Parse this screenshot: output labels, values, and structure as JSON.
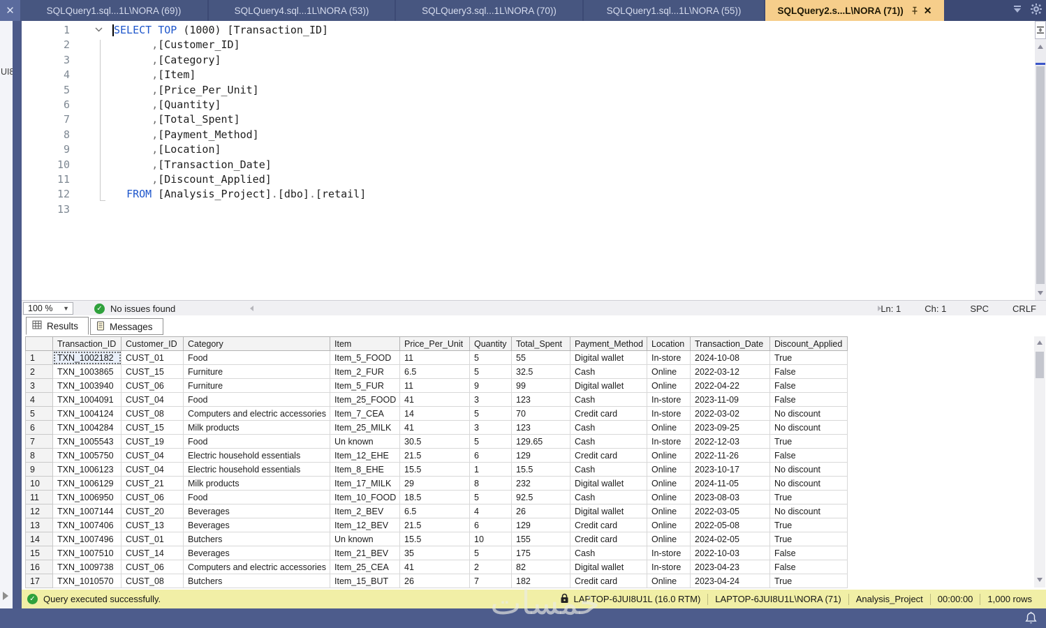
{
  "window": {
    "app": "SQL Server Management Studio"
  },
  "tab_bar": {
    "close_all_label": "✕",
    "tabs": [
      {
        "label": "SQLQuery1.sql...1L\\NORA (69))",
        "active": false
      },
      {
        "label": "SQLQuery4.sql...1L\\NORA (53))",
        "active": false
      },
      {
        "label": "SQLQuery3.sql...1L\\NORA (70))",
        "active": false
      },
      {
        "label": "SQLQuery1.sql...1L\\NORA (55))",
        "active": false
      },
      {
        "label": "SQLQuery2.s...L\\NORA (71))",
        "active": true
      }
    ]
  },
  "side_strip": {
    "label": "UI8"
  },
  "editor": {
    "keywords": [
      "SELECT",
      "TOP",
      "FROM"
    ],
    "lines": [
      "SELECT TOP (1000) [Transaction_ID]",
      "      ,[Customer_ID]",
      "      ,[Category]",
      "      ,[Item]",
      "      ,[Price_Per_Unit]",
      "      ,[Quantity]",
      "      ,[Total_Spent]",
      "      ,[Payment_Method]",
      "      ,[Location]",
      "      ,[Transaction_Date]",
      "      ,[Discount_Applied]",
      "  FROM [Analysis_Project].[dbo].[retail]",
      ""
    ]
  },
  "editor_status": {
    "zoom": "100 %",
    "health": "No issues found",
    "line": "Ln: 1",
    "char": "Ch: 1",
    "spaces": "SPC",
    "eol": "CRLF"
  },
  "results_panel": {
    "tabs": [
      {
        "label": "Results",
        "active": true
      },
      {
        "label": "Messages",
        "active": false
      }
    ]
  },
  "grid": {
    "columns": [
      "Transaction_ID",
      "Customer_ID",
      "Category",
      "Item",
      "Price_Per_Unit",
      "Quantity",
      "Total_Spent",
      "Payment_Method",
      "Location",
      "Transaction_Date",
      "Discount_Applied"
    ],
    "selected_cell": {
      "row": 0,
      "col": 0
    },
    "rows": [
      [
        "TXN_1002182",
        "CUST_01",
        "Food",
        "Item_5_FOOD",
        "11",
        "5",
        "55",
        "Digital wallet",
        "In-store",
        "2024-10-08",
        "True"
      ],
      [
        "TXN_1003865",
        "CUST_15",
        "Furniture",
        "Item_2_FUR",
        "6.5",
        "5",
        "32.5",
        "Cash",
        "Online",
        "2022-03-12",
        "False"
      ],
      [
        "TXN_1003940",
        "CUST_06",
        "Furniture",
        "Item_5_FUR",
        "11",
        "9",
        "99",
        "Digital wallet",
        "Online",
        "2022-04-22",
        "False"
      ],
      [
        "TXN_1004091",
        "CUST_04",
        "Food",
        "Item_25_FOOD",
        "41",
        "3",
        "123",
        "Cash",
        "In-store",
        "2023-11-09",
        "False"
      ],
      [
        "TXN_1004124",
        "CUST_08",
        "Computers and electric accessories",
        "Item_7_CEA",
        "14",
        "5",
        "70",
        "Credit card",
        "In-store",
        "2022-03-02",
        "No discount"
      ],
      [
        "TXN_1004284",
        "CUST_15",
        "Milk products",
        "Item_25_MILK",
        "41",
        "3",
        "123",
        "Cash",
        "Online",
        "2023-09-25",
        "No discount"
      ],
      [
        "TXN_1005543",
        "CUST_19",
        "Food",
        "Un known",
        "30.5",
        "5",
        "129.65",
        "Cash",
        "In-store",
        "2022-12-03",
        "True"
      ],
      [
        "TXN_1005750",
        "CUST_04",
        "Electric household essentials",
        "Item_12_EHE",
        "21.5",
        "6",
        "129",
        "Credit card",
        "Online",
        "2022-11-26",
        "False"
      ],
      [
        "TXN_1006123",
        "CUST_04",
        "Electric household essentials",
        "Item_8_EHE",
        "15.5",
        "1",
        "15.5",
        "Cash",
        "Online",
        "2023-10-17",
        "No discount"
      ],
      [
        "TXN_1006129",
        "CUST_21",
        "Milk products",
        "Item_17_MILK",
        "29",
        "8",
        "232",
        "Digital wallet",
        "Online",
        "2024-11-05",
        "No discount"
      ],
      [
        "TXN_1006950",
        "CUST_06",
        "Food",
        "Item_10_FOOD",
        "18.5",
        "5",
        "92.5",
        "Cash",
        "Online",
        "2023-08-03",
        "True"
      ],
      [
        "TXN_1007144",
        "CUST_20",
        "Beverages",
        "Item_2_BEV",
        "6.5",
        "4",
        "26",
        "Digital wallet",
        "Online",
        "2022-03-05",
        "No discount"
      ],
      [
        "TXN_1007406",
        "CUST_13",
        "Beverages",
        "Item_12_BEV",
        "21.5",
        "6",
        "129",
        "Credit card",
        "Online",
        "2022-05-08",
        "True"
      ],
      [
        "TXN_1007496",
        "CUST_01",
        "Butchers",
        "Un known",
        "15.5",
        "10",
        "155",
        "Credit card",
        "Online",
        "2024-02-05",
        "True"
      ],
      [
        "TXN_1007510",
        "CUST_14",
        "Beverages",
        "Item_21_BEV",
        "35",
        "5",
        "175",
        "Cash",
        "In-store",
        "2022-10-03",
        "False"
      ],
      [
        "TXN_1009738",
        "CUST_06",
        "Computers and electric accessories",
        "Item_25_CEA",
        "41",
        "2",
        "82",
        "Digital wallet",
        "In-store",
        "2023-04-23",
        "False"
      ],
      [
        "TXN_1010570",
        "CUST_08",
        "Butchers",
        "Item_15_BUT",
        "26",
        "7",
        "182",
        "Credit card",
        "Online",
        "2023-04-24",
        "True"
      ]
    ]
  },
  "status_bar": {
    "message": "Query executed successfully.",
    "server": "LAPTOP-6JUI8U1L (16.0 RTM)",
    "login": "LAPTOP-6JUI8U1L\\NORA (71)",
    "database": "Analysis_Project",
    "duration": "00:00:00",
    "row_count": "1,000 rows"
  },
  "watermark": "خمسات",
  "colors": {
    "tab_bar": "#3C4974",
    "active_tab": "#F6CE8B",
    "status_bar_success": "#F1EFA6",
    "success_green": "#2FA13C",
    "keyword_blue": "#1E56CB",
    "taskbar": "#4D5C8C"
  }
}
